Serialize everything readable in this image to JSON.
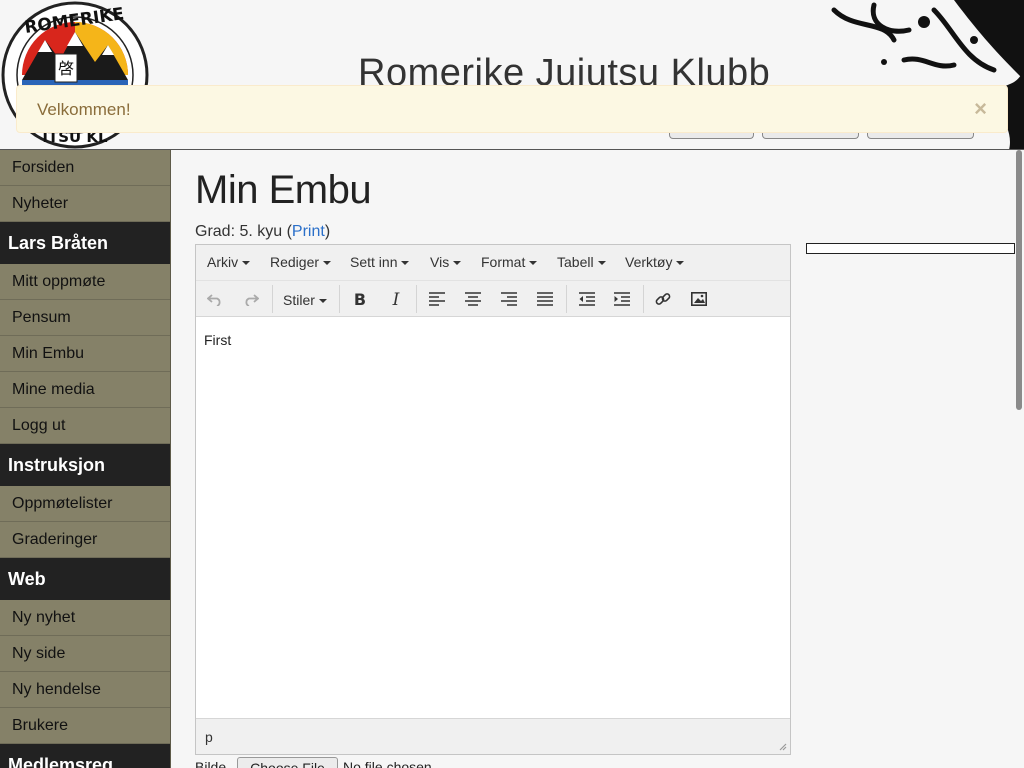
{
  "header": {
    "site_title": "Romerike Jujutsu Klubb",
    "logo_top_text": "ROMERIKE",
    "logo_bottom_text": "ITSU KL",
    "logo_glyph": "啓"
  },
  "alert": {
    "message": "Velkommen!",
    "close_symbol": "×"
  },
  "sidebar": {
    "main": [
      "Forsiden",
      "Nyheter"
    ],
    "sections": [
      {
        "title": "Lars Bråten",
        "items": [
          "Mitt oppmøte",
          "Pensum",
          "Min Embu",
          "Mine media",
          "Logg ut"
        ]
      },
      {
        "title": "Instruksjon",
        "items": [
          "Oppmøtelister",
          "Graderinger"
        ]
      },
      {
        "title": "Web",
        "items": [
          "Ny nyhet",
          "Ny side",
          "Ny hendelse",
          "Brukere"
        ]
      },
      {
        "title": "Medlemsreg",
        "items": []
      }
    ]
  },
  "page": {
    "title": "Min Embu",
    "grade_prefix": "Grad: 5. kyu (",
    "print_link": "Print",
    "grade_suffix": ")"
  },
  "editor": {
    "menus": [
      "Arkiv",
      "Rediger",
      "Sett inn",
      "Vis",
      "Format",
      "Tabell",
      "Verktøy"
    ],
    "styles_label": "Stiler",
    "content_text": "First",
    "status_path": "p",
    "icons": [
      "undo-icon",
      "redo-icon",
      "bold-icon",
      "italic-icon",
      "align-left-icon",
      "align-center-icon",
      "align-right-icon",
      "align-justify-icon",
      "outdent-icon",
      "indent-icon",
      "link-icon",
      "image-icon"
    ]
  },
  "file_upload": {
    "label": "Bilde",
    "button_label": "Choose File",
    "status": "No file chosen"
  },
  "colors": {
    "sidebar_bg": "#858168",
    "section_header_bg": "#222222",
    "alert_bg": "#fcf8e3",
    "alert_text": "#8a6d3b",
    "link": "#2a6fc9"
  }
}
